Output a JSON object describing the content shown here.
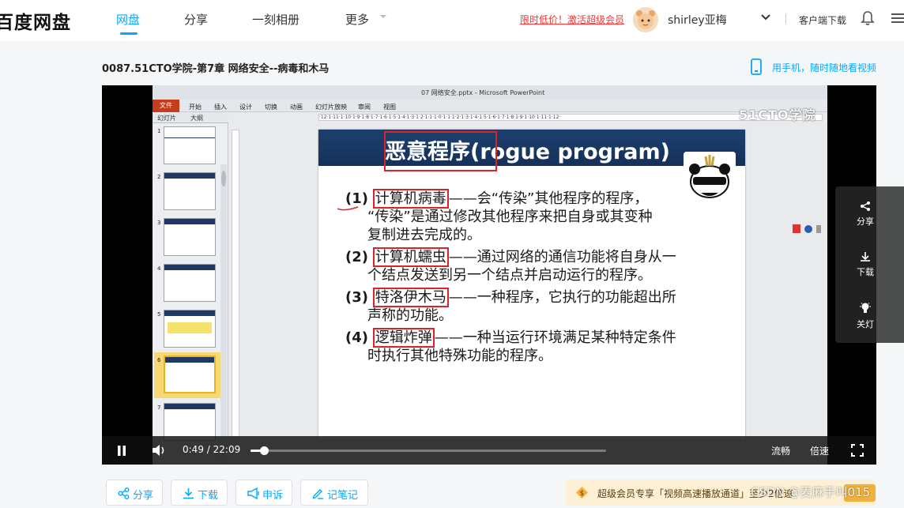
{
  "topnav": {
    "logo": "百度网盘",
    "tabs": [
      {
        "label": "网盘",
        "active": true
      },
      {
        "label": "分享"
      },
      {
        "label": "一刻相册"
      },
      {
        "label": "更多"
      }
    ],
    "promo": "限时低价！激活超级会员",
    "username": "shirley亚梅",
    "client_download": "客户端下载"
  },
  "video": {
    "title": "0087.51CTO学院-第7章 网络安全--病毒和木马",
    "phone_link": "用手机，随时随地看视频"
  },
  "ppt": {
    "window_title": "07 网络安全.pptx - Microsoft PowerPoint",
    "file_tab": "文件",
    "ribbon_tabs": [
      "开始",
      "插入",
      "设计",
      "切换",
      "动画",
      "幻灯片放映",
      "审阅",
      "视图"
    ],
    "panel_tabs": [
      "幻灯片",
      "大纲"
    ],
    "thumb_numbers": [
      "1",
      "2",
      "3",
      "4",
      "5",
      "6",
      "7"
    ],
    "watermark": "51CTO学院",
    "ruler": "·12·1·11·1·10·1·9·1·8·1·7·1·6·1·5·1·4·1·3·1·2·1·1·1·0·1·1·1·2·1·3·1·4·1·5·1·6·1·7·1·8·1·9·1·10·1·11·1·12·"
  },
  "slide": {
    "title_cn": "恶意程序",
    "title_en": "(rogue program)",
    "items": [
      {
        "num": "(1)",
        "term": "计算机病毒",
        "rest": "——会“传染”其他程序的程序，",
        "cont": [
          "“传染”是通过修改其他程序来把自身或其变种",
          "复制进去完成的。"
        ]
      },
      {
        "num": "(2)",
        "term": "计算机蠕虫",
        "rest": "——通过网络的通信功能将自身从一",
        "cont": [
          "个结点发送到另一个结点并启动运行的程序。"
        ]
      },
      {
        "num": "(3)",
        "term": "特洛伊木马",
        "rest": "——一种程序，它执行的功能超出所",
        "cont": [
          "声称的功能。"
        ]
      },
      {
        "num": "(4)",
        "term": "逻辑炸弹",
        "rest": "——一种当运行环境满足某种特定条件",
        "cont": [
          "时执行其他特殊功能的程序。"
        ]
      }
    ]
  },
  "controls": {
    "current_time": "0:49",
    "separator": "/",
    "total_time": "22:09",
    "progress_fraction": 0.037,
    "quality": "流畅",
    "speed": "倍速"
  },
  "sidefloat": {
    "share": "分享",
    "download": "下载",
    "lights": "关灯"
  },
  "actions": {
    "share": "分享",
    "download": "下载",
    "report": "申诉",
    "notes": "记笔记"
  },
  "vip": {
    "text": "超级会员专享「视频高速播放通道」至少2倍速"
  },
  "watermark_csdn": "CSDN @麦麻手叫015",
  "colors": {
    "accent": "#06a7ff",
    "promo_red": "#ff3333",
    "slide_header": "#1e3f6e",
    "highlight_red": "#d9252a"
  }
}
